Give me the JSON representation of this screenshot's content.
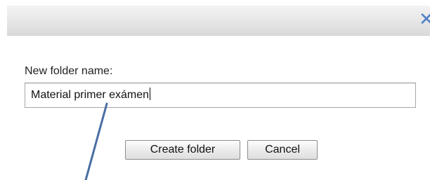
{
  "dialog": {
    "close_glyph": "✕",
    "field_label": "New folder name:",
    "input_value": "Material primer exámen",
    "create_label": "Create folder",
    "cancel_label": "Cancel"
  },
  "colors": {
    "close_icon": "#4f7fc6",
    "annotation_line": "#4a6fa5"
  },
  "icons": {
    "close": "close-icon"
  }
}
